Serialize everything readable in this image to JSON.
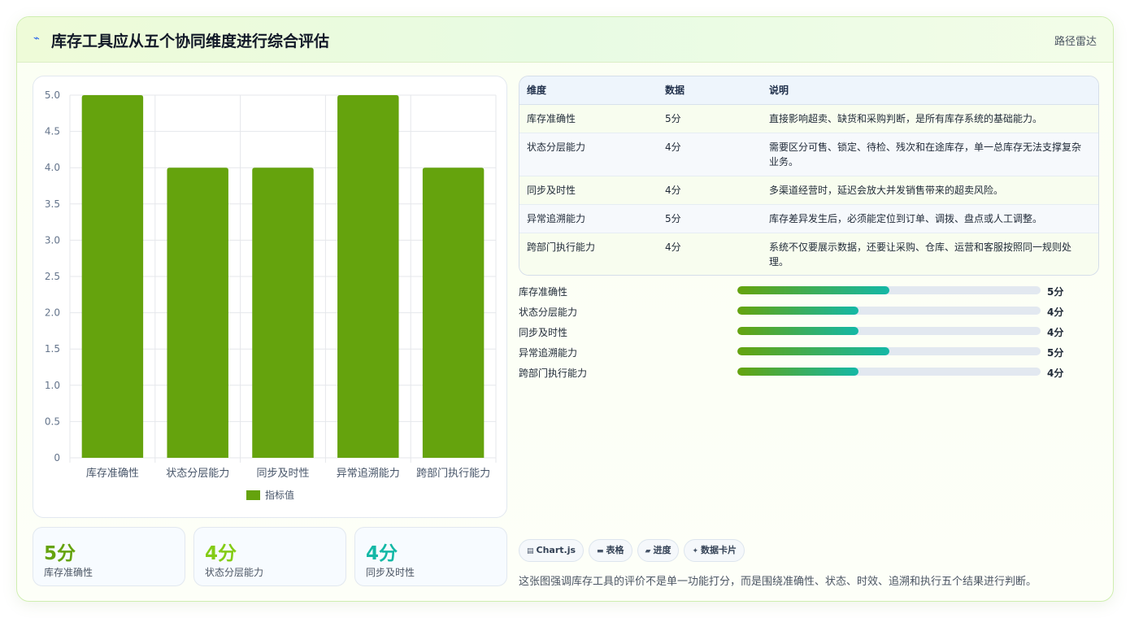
{
  "header": {
    "title": "库存工具应从五个协同维度进行综合评估",
    "tag": "路径雷达",
    "logo_icon": "lightning-icon"
  },
  "chart_data": {
    "type": "bar",
    "categories": [
      "库存准确性",
      "状态分层能力",
      "同步及时性",
      "异常追溯能力",
      "跨部门执行能力"
    ],
    "series": [
      {
        "name": "指标值",
        "values": [
          5,
          4,
          4,
          5,
          4
        ],
        "color": "#65a30d"
      }
    ],
    "ylim": [
      0,
      5
    ],
    "yticks": [
      "0",
      "0.5",
      "1.0",
      "1.5",
      "2.0",
      "2.5",
      "3.0",
      "3.5",
      "4.0",
      "4.5",
      "5.0"
    ],
    "grid": true,
    "legend": "bottom"
  },
  "kpis": [
    {
      "value": "5分",
      "label": "库存准确性",
      "color": "#65a30d"
    },
    {
      "value": "4分",
      "label": "状态分层能力",
      "color": "#84cc16"
    },
    {
      "value": "4分",
      "label": "同步及时性",
      "color": "#14b8a6"
    }
  ],
  "table": {
    "headers": [
      "维度",
      "数据",
      "说明"
    ],
    "rows": [
      [
        "库存准确性",
        "5分",
        "直接影响超卖、缺货和采购判断，是所有库存系统的基础能力。"
      ],
      [
        "状态分层能力",
        "4分",
        "需要区分可售、锁定、待检、残次和在途库存，单一总库存无法支撑复杂业务。"
      ],
      [
        "同步及时性",
        "4分",
        "多渠道经营时，延迟会放大并发销售带来的超卖风险。"
      ],
      [
        "异常追溯能力",
        "5分",
        "库存差异发生后，必须能定位到订单、调拨、盘点或人工调整。"
      ],
      [
        "跨部门执行能力",
        "4分",
        "系统不仅要展示数据，还要让采购、仓库、运营和客服按照同一规则处理。"
      ]
    ]
  },
  "progress": {
    "max": 10,
    "items": [
      {
        "label": "库存准确性",
        "value": 5,
        "text": "5分"
      },
      {
        "label": "状态分层能力",
        "value": 4,
        "text": "4分"
      },
      {
        "label": "同步及时性",
        "value": 4,
        "text": "4分"
      },
      {
        "label": "异常追溯能力",
        "value": 5,
        "text": "5分"
      },
      {
        "label": "跨部门执行能力",
        "value": 4,
        "text": "4分"
      }
    ]
  },
  "chips": [
    {
      "icon": "chart-icon",
      "glyph": "▤",
      "label": "Chart.js"
    },
    {
      "icon": "table-icon",
      "glyph": "▬",
      "label": "表格"
    },
    {
      "icon": "progress-icon",
      "glyph": "▰",
      "label": "进度"
    },
    {
      "icon": "sparkle-icon",
      "glyph": "✦",
      "label": "数据卡片"
    }
  ],
  "caption": "这张图强调库存工具的评价不是单一功能打分，而是围绕准确性、状态、时效、追溯和执行五个结果进行判断。"
}
